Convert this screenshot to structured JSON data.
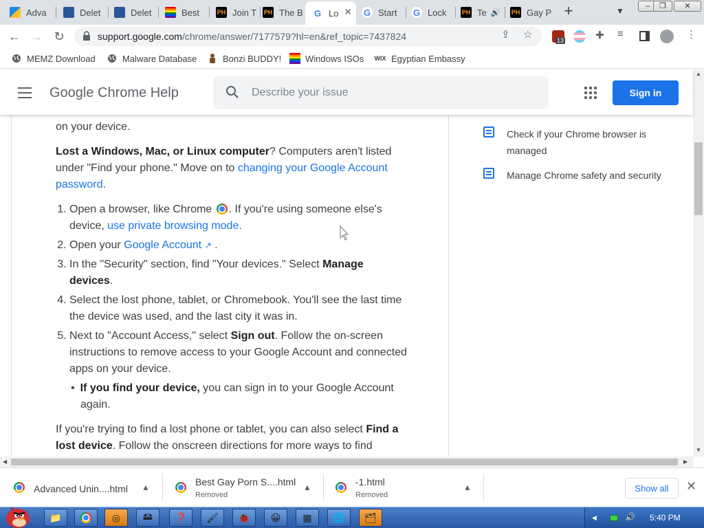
{
  "browser": {
    "tabs": [
      {
        "title": "Adva",
        "icon": "advanced-uninstaller-icon",
        "active": false
      },
      {
        "title": "Delet",
        "icon": "ms-icon",
        "active": false
      },
      {
        "title": "Delet",
        "icon": "ms-icon",
        "active": false
      },
      {
        "title": "Best",
        "icon": "rainbow-flag-icon",
        "active": false
      },
      {
        "title": "Join T",
        "icon": "ph-icon",
        "active": false
      },
      {
        "title": "The B",
        "icon": "ph-icon",
        "active": false
      },
      {
        "title": "Lo",
        "icon": "google-icon",
        "active": true
      },
      {
        "title": "Start",
        "icon": "google-icon",
        "active": false
      },
      {
        "title": "Lock",
        "icon": "google-icon",
        "active": false
      },
      {
        "title": "Te",
        "icon": "ph-icon",
        "active": false
      },
      {
        "title": "Gay P",
        "icon": "ph-icon",
        "active": false
      }
    ],
    "url_host": "support.google.com",
    "url_path": "/chrome/answer/7177579?hl=en&ref_topic=7437824",
    "ext_badge": "13",
    "bookmarks": [
      {
        "label": "MEMZ Download",
        "icon": "globe-icon"
      },
      {
        "label": "Malware Database",
        "icon": "globe-icon"
      },
      {
        "label": "Bonzi BUDDY!",
        "icon": "bonzi-icon"
      },
      {
        "label": "Windows ISOs",
        "icon": "rainbow-flag-icon"
      },
      {
        "label": "Egyptian Embassy",
        "icon": "wix-icon"
      }
    ],
    "wix_label": "WIX"
  },
  "header": {
    "title": "Google Chrome Help",
    "search_placeholder": "Describe your issue",
    "signin_label": "Sign in"
  },
  "article": {
    "top_fragment": "on your device.",
    "p1_bold": "Lost a Windows, Mac, or Linux computer",
    "p1_text": "? Computers aren't listed under \"Find your phone.\" Move on to ",
    "p1_link": "changing your Google Account password",
    "p1_end": ".",
    "step1_a": "Open a browser, like Chrome ",
    "step1_b": ". If you're using someone else's device, ",
    "step1_link": "use private browsing mode",
    "step1_end": ".",
    "step2_a": "Open your ",
    "step2_link": "Google Account",
    "step2_end": " .",
    "step3_a": "In the \"Security\" section, find \"Your devices.\" Select ",
    "step3_bold": "Manage devices",
    "step3_end": ".",
    "step4": "Select the lost phone, tablet, or Chromebook. You'll see the last time the device was used, and the last city it was in.",
    "step5_a": "Next to \"Account Access,\" select ",
    "step5_bold": "Sign out",
    "step5_b": ". Follow the  on-screen instructions to remove access to your Google Account and connected apps on your device.",
    "bullet_bold": "If you find your device,",
    "bullet_text": " you can sign in to your Google Account again.",
    "p2_a": "If you're trying to find a lost phone or tablet, you can also select ",
    "p2_bold": "Find a lost device",
    "p2_b": ". Follow the onscreen directions for more ways to find"
  },
  "sidebar": {
    "items": [
      {
        "label": "Check if your Chrome browser is managed"
      },
      {
        "label": "Manage Chrome safety and security"
      }
    ]
  },
  "downloads": {
    "items": [
      {
        "name": "Advanced Unin....html",
        "status": ""
      },
      {
        "name": "Best Gay Porn S....html",
        "status": "Removed"
      },
      {
        "name": "-1.html",
        "status": "Removed"
      }
    ],
    "show_all_label": "Show all"
  },
  "taskbar": {
    "clock": "5:40 PM"
  },
  "colors": {
    "accent": "#1a73e8",
    "tabstrip": "#dee1e6",
    "taskbar": "#2a5aa8"
  }
}
